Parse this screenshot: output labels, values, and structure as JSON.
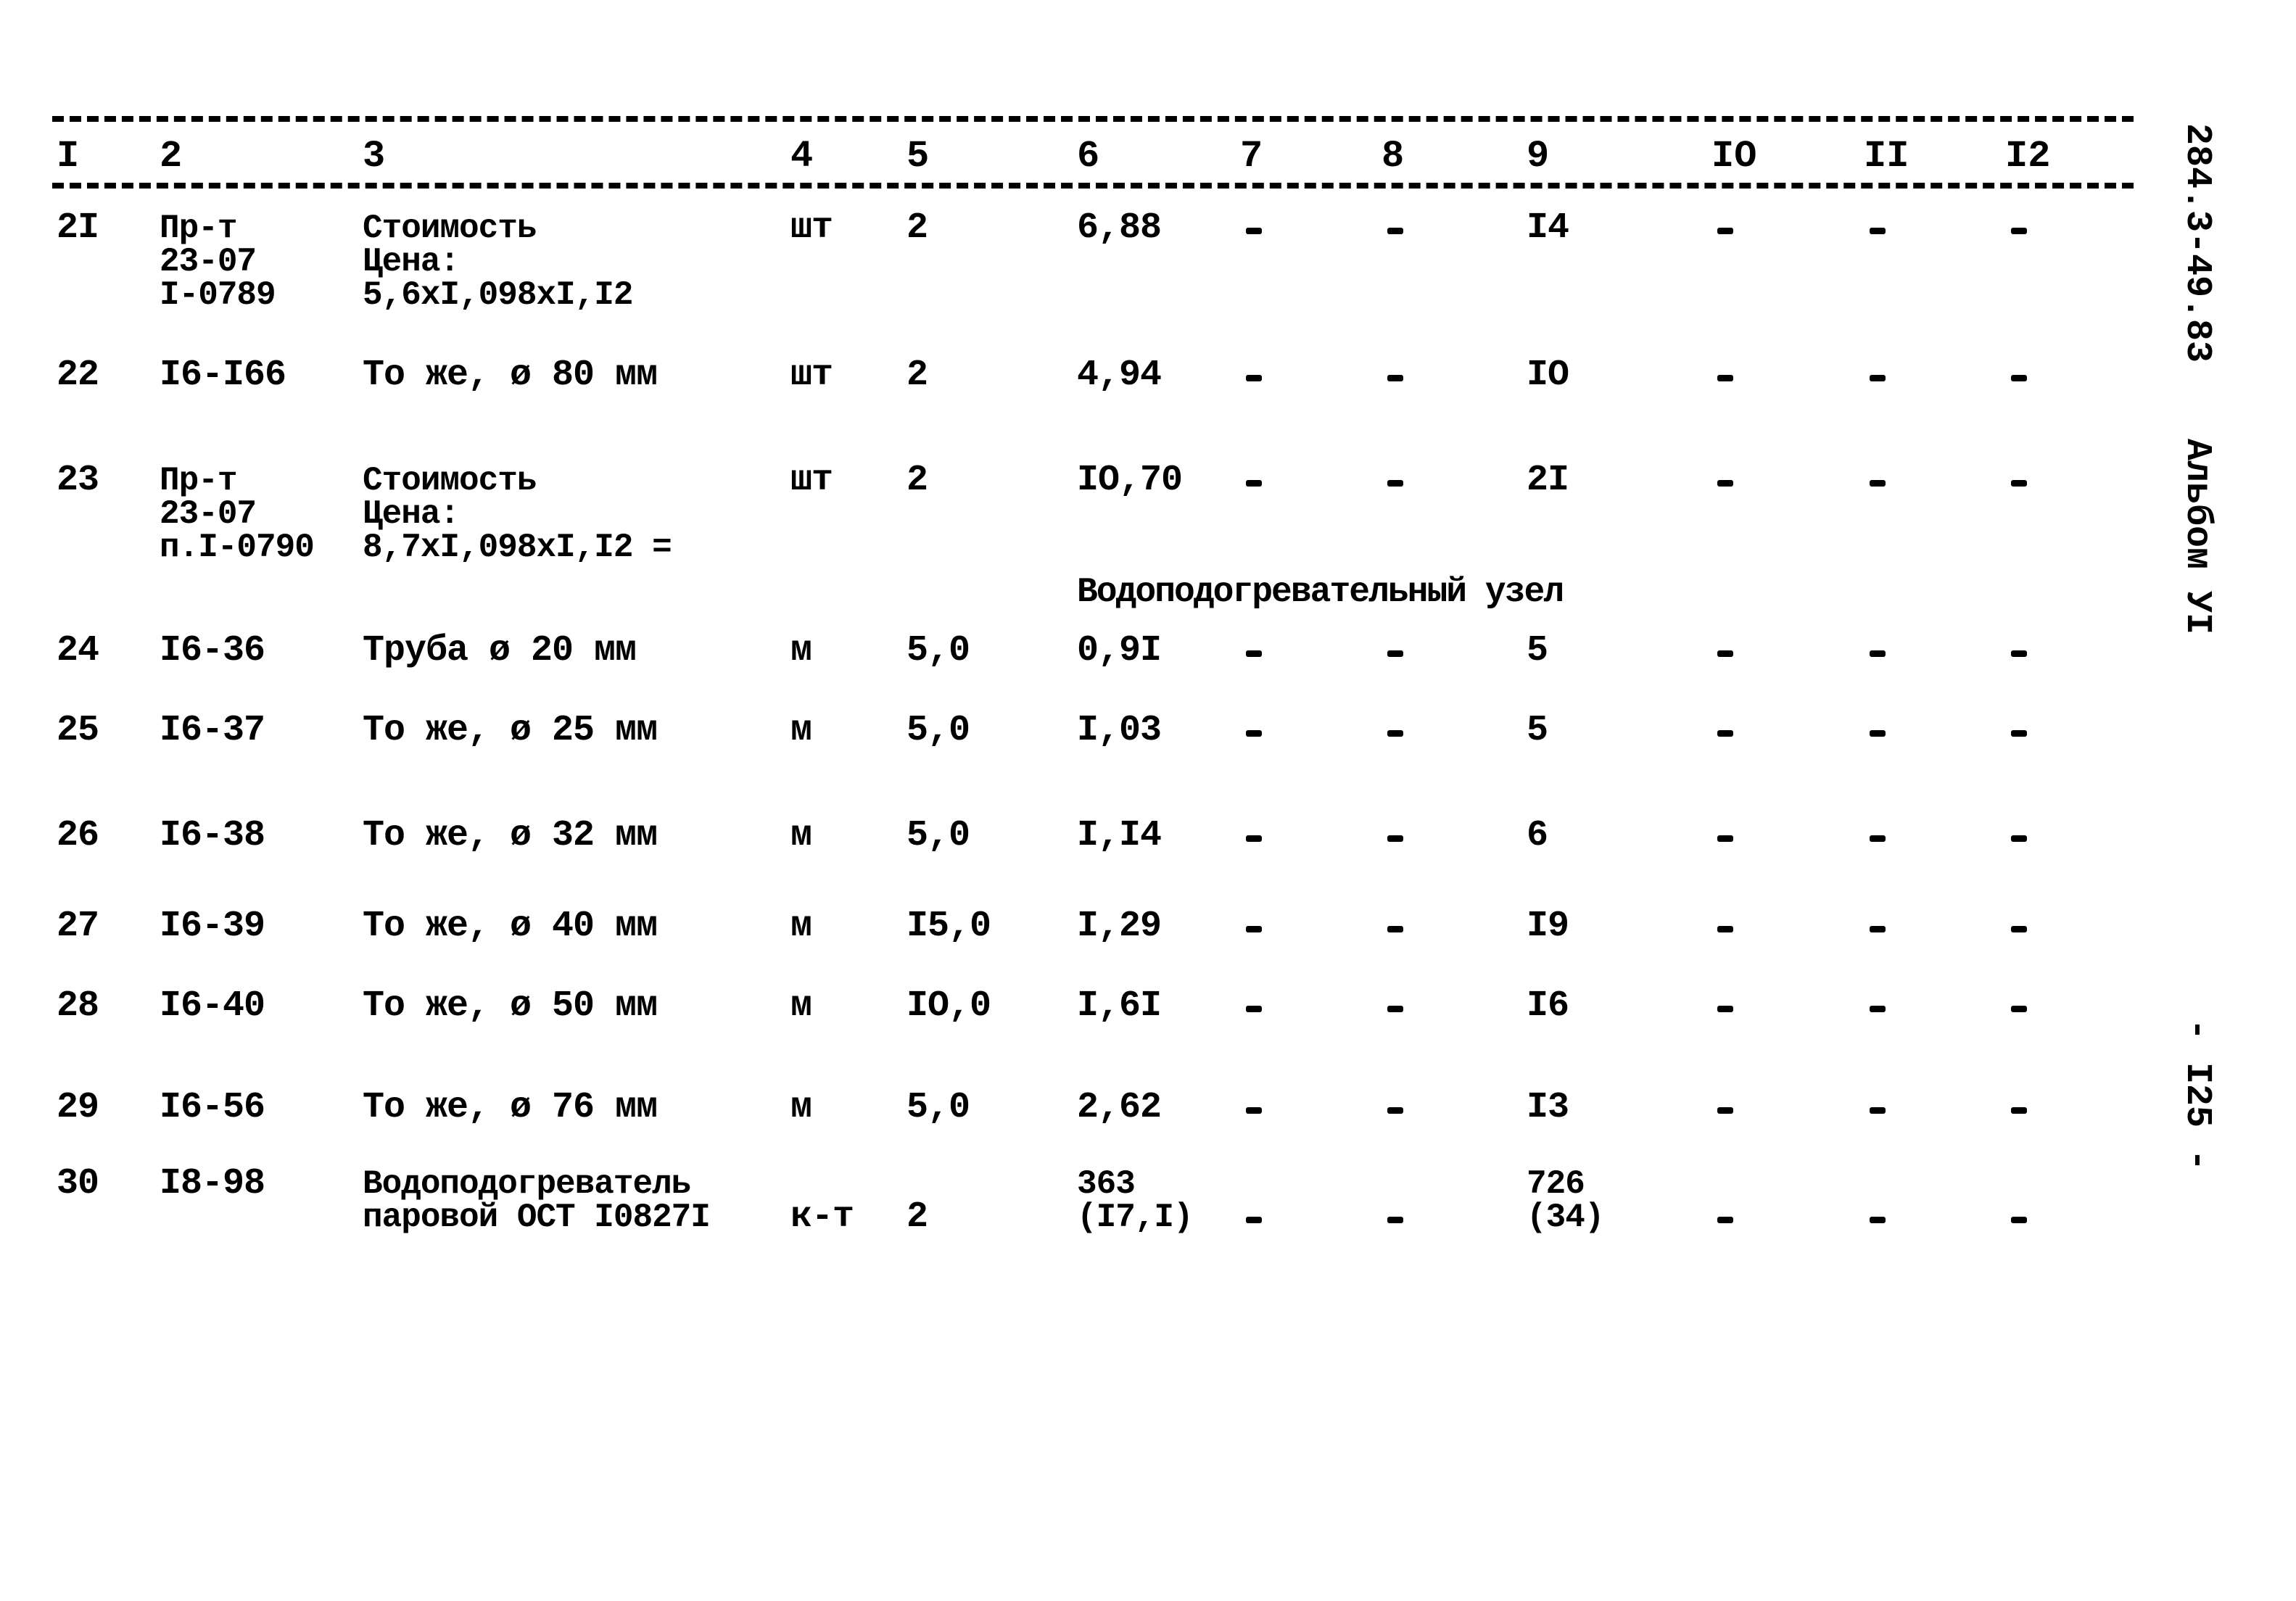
{
  "document": {
    "side_code": "284.3-49.83",
    "album": "Альбом УI",
    "page_number": "- I25 -"
  },
  "table": {
    "columns": [
      "I",
      "2",
      "3",
      "4",
      "5",
      "6",
      "7",
      "8",
      "9",
      "IO",
      "II",
      "I2"
    ],
    "section_title": "Водоподогревательный узел",
    "rows": [
      {
        "n": "2I",
        "code": [
          "Пр-т",
          "23-07",
          "I-0789"
        ],
        "name": [
          "Стоимость",
          "Цена:",
          "5,6xI,098xI,I2"
        ],
        "unit": "шт",
        "qty": "2",
        "price": [
          "6,88"
        ],
        "c7": "-",
        "c8": "-",
        "c9": [
          "I4"
        ],
        "c10": "-",
        "c11": "-",
        "c12": "-"
      },
      {
        "n": "22",
        "code": [
          "I6-I66"
        ],
        "name": [
          "То же, ø 80 мм"
        ],
        "unit": "шт",
        "qty": "2",
        "price": [
          "4,94"
        ],
        "c7": "-",
        "c8": "-",
        "c9": [
          "IO"
        ],
        "c10": "-",
        "c11": "-",
        "c12": "-"
      },
      {
        "n": "23",
        "code": [
          "Пр-т",
          "23-07",
          "п.I-0790"
        ],
        "name": [
          "Стоимость",
          "Цена:",
          "8,7xI,098xI,I2 ="
        ],
        "unit": "шт",
        "qty": "2",
        "price": [
          "IO,70"
        ],
        "c7": "-",
        "c8": "-",
        "c9": [
          "2I"
        ],
        "c10": "-",
        "c11": "-",
        "c12": "-"
      },
      {
        "n": "24",
        "code": [
          "I6-36"
        ],
        "name": [
          "Труба ø 20 мм"
        ],
        "unit": "м",
        "qty": "5,0",
        "price": [
          "0,9I"
        ],
        "c7": "-",
        "c8": "-",
        "c9": [
          "5"
        ],
        "c10": "-",
        "c11": "-",
        "c12": "-"
      },
      {
        "n": "25",
        "code": [
          "I6-37"
        ],
        "name": [
          "То же, ø 25 мм"
        ],
        "unit": "м",
        "qty": "5,0",
        "price": [
          "I,03"
        ],
        "c7": "-",
        "c8": "-",
        "c9": [
          "5"
        ],
        "c10": "-",
        "c11": "-",
        "c12": "-"
      },
      {
        "n": "26",
        "code": [
          "I6-38"
        ],
        "name": [
          "То же, ø 32 мм"
        ],
        "unit": "м",
        "qty": "5,0",
        "price": [
          "I,I4"
        ],
        "c7": "-",
        "c8": "-",
        "c9": [
          "6"
        ],
        "c10": "-",
        "c11": "-",
        "c12": "-"
      },
      {
        "n": "27",
        "code": [
          "I6-39"
        ],
        "name": [
          "То же, ø 40 мм"
        ],
        "unit": "м",
        "qty": "I5,0",
        "price": [
          "I,29"
        ],
        "c7": "-",
        "c8": "-",
        "c9": [
          "I9"
        ],
        "c10": "-",
        "c11": "-",
        "c12": "-"
      },
      {
        "n": "28",
        "code": [
          "I6-40"
        ],
        "name": [
          "То же, ø 50 мм"
        ],
        "unit": "м",
        "qty": "IO,0",
        "price": [
          "I,6I"
        ],
        "c7": "-",
        "c8": "-",
        "c9": [
          "I6"
        ],
        "c10": "-",
        "c11": "-",
        "c12": "-"
      },
      {
        "n": "29",
        "code": [
          "I6-56"
        ],
        "name": [
          "То же, ø 76 мм"
        ],
        "unit": "м",
        "qty": "5,0",
        "price": [
          "2,62"
        ],
        "c7": "-",
        "c8": "-",
        "c9": [
          "I3"
        ],
        "c10": "-",
        "c11": "-",
        "c12": "-"
      },
      {
        "n": "30",
        "code": [
          "I8-98"
        ],
        "name": [
          "Водоподогреватель",
          "паровой ОСТ I0827I"
        ],
        "unit": "к-т",
        "qty": "2",
        "price": [
          "363",
          "(I7,I)"
        ],
        "c7": "-",
        "c8": "-",
        "c9": [
          "726",
          "(34)"
        ],
        "c10": "-",
        "c11": "-",
        "c12": "-"
      }
    ]
  }
}
